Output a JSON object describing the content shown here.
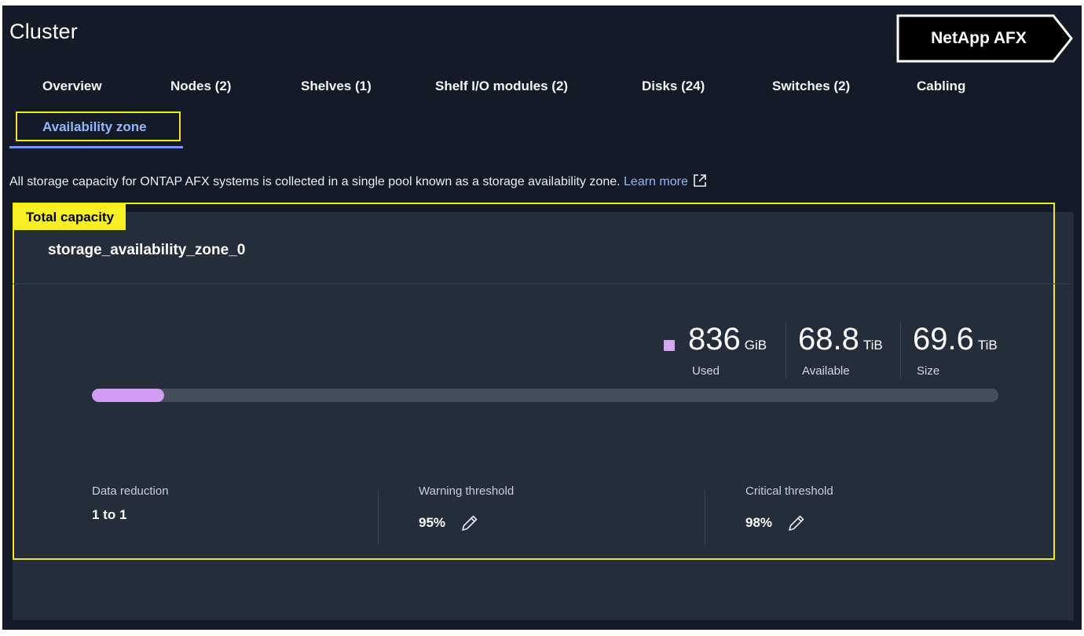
{
  "page": {
    "title": "Cluster"
  },
  "product_tag": {
    "label": "NetApp AFX"
  },
  "tabs": [
    {
      "label": "Overview"
    },
    {
      "label": "Nodes (2)"
    },
    {
      "label": "Shelves (1)"
    },
    {
      "label": "Shelf I/O modules (2)"
    },
    {
      "label": "Disks (24)"
    },
    {
      "label": "Switches (2)"
    },
    {
      "label": "Cabling"
    },
    {
      "label": "Availability zone"
    }
  ],
  "intro": {
    "text": "All storage capacity for ONTAP AFX systems is collected in a single pool known as a storage availability zone.",
    "link": "Learn more",
    "link_icon": "external-link-icon"
  },
  "capacity": {
    "badge": "Total capacity",
    "zone_name": "storage_availability_zone_0",
    "used": {
      "value": "836",
      "unit": "GiB",
      "label": "Used"
    },
    "available": {
      "value": "68.8",
      "unit": "TiB",
      "label": "Available"
    },
    "size": {
      "value": "69.6",
      "unit": "TiB",
      "label": "Size"
    },
    "used_fraction": 0.08,
    "used_color": "#d29cf5",
    "track_color": "#474e5d"
  },
  "metrics": {
    "data_reduction": {
      "label": "Data reduction",
      "value": "1 to 1"
    },
    "warning_threshold": {
      "label": "Warning threshold",
      "value": "95%",
      "icon": "pencil-icon"
    },
    "critical_threshold": {
      "label": "Critical threshold",
      "value": "98%",
      "icon": "pencil-icon"
    }
  },
  "colors": {
    "background": "#151b26",
    "panel": "#252c3a",
    "accent_link": "#8fb8ff",
    "highlight": "#f2ea1a"
  }
}
